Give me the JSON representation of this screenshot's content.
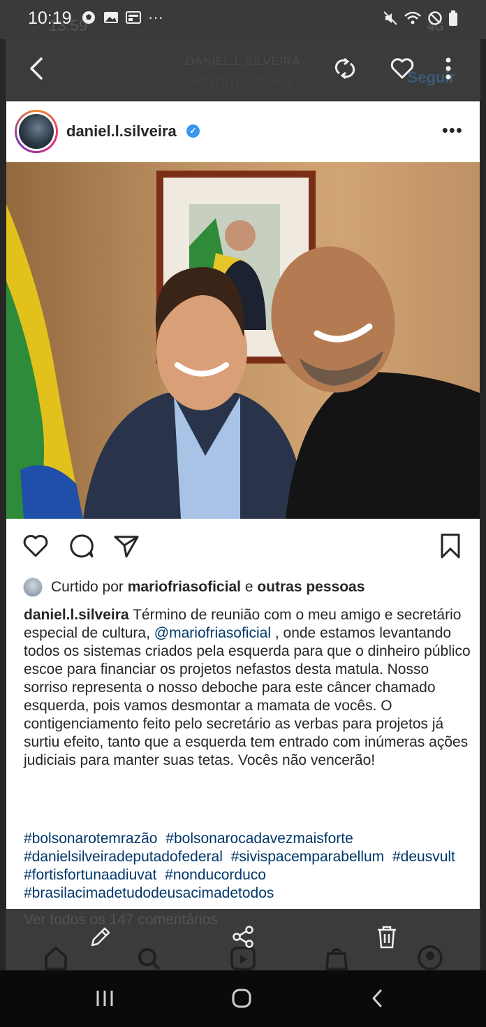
{
  "status_bar": {
    "time": "10:19",
    "ghost_time": "13:59",
    "network": "4G"
  },
  "header": {
    "username_caps": "DANIEL.L.SILVEIRA",
    "title": "Publicações",
    "follow_label": "Seguir"
  },
  "post": {
    "username": "daniel.l.silveira",
    "verified": true,
    "liked_by_prefix": "Curtido por",
    "liked_by_user": "mariofriasoficial",
    "liked_by_conjunction": "e",
    "liked_by_others": "outras pessoas",
    "caption_user": "daniel.l.silveira",
    "caption_part1": "Término de reunião com o meu amigo e secretário especial de cultura,",
    "caption_mention": "@mariofriasoficial",
    "caption_part2": ", onde estamos levantando todos os sistemas criados pela esquerda para que o dinheiro público escoe para financiar os projetos nefastos desta matula. Nosso sorriso representa o nosso deboche para este câncer chamado esquerda, pois vamos desmontar a mamata de vocês. O contigenciamento feito pelo secretário as verbas para projetos já surtiu efeito, tanto que a esquerda tem entrado com inúmeras ações judiciais para manter suas tetas. Vocês não vencerão!",
    "hashtags": [
      "#bolsonarotemrazão",
      "#bolsonarocadavezmaisforte",
      "#danielsilveiradeputadofederal",
      "#sivispacemparabellum",
      "#deusvult",
      "#fortisfortunaadiuvat",
      "#nonducorduco",
      "#brasilacimadetudodeusacimadetodos"
    ],
    "view_comments": "Ver todos os 147 comentários"
  },
  "icons": {
    "back": "back-arrow-icon",
    "rotate": "rotate-icon",
    "favorite": "heart-outline-icon",
    "more": "more-vertical-icon",
    "edit": "pencil-icon",
    "share": "share-icon",
    "delete": "trash-icon"
  },
  "colors": {
    "link": "#00376b",
    "verified": "#3897f0",
    "viewer_bar": "#3b3b3b"
  }
}
